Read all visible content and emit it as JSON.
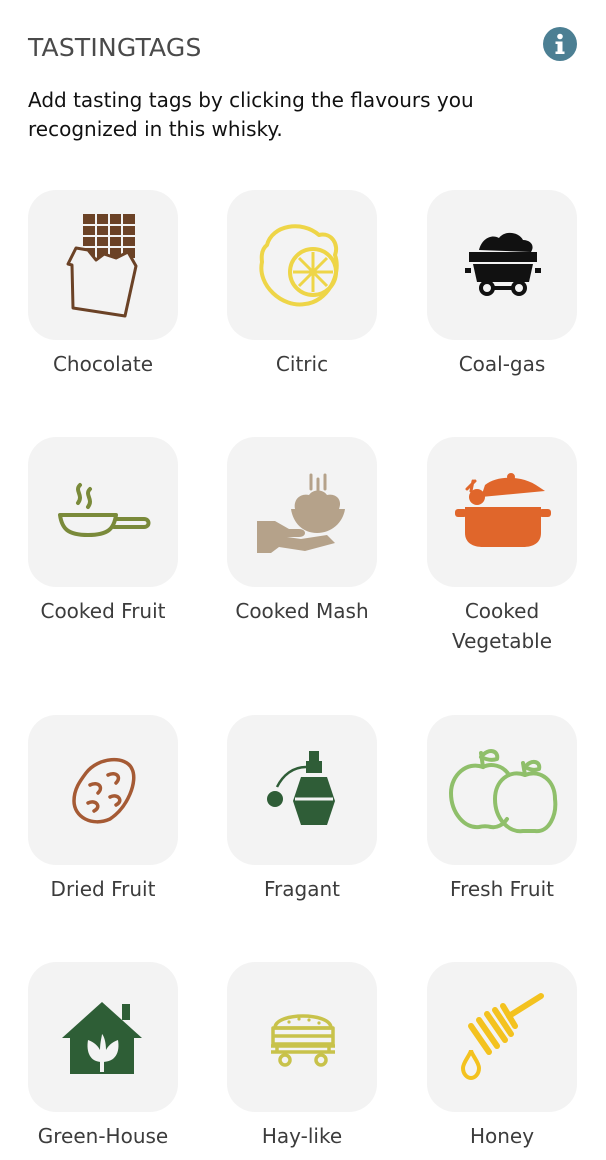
{
  "header": {
    "title": "TASTINGTAGS",
    "info_icon": "info-circle-icon",
    "intro": "Add tasting tags by clicking the flavours you recognized in this whisky."
  },
  "tags": [
    {
      "label": "Chocolate",
      "icon": "chocolate-bar-icon",
      "color": "#6b4226"
    },
    {
      "label": "Citric",
      "icon": "lemon-icon",
      "color": "#eed547"
    },
    {
      "label": "Coal-gas",
      "icon": "coal-cart-icon",
      "color": "#111111"
    },
    {
      "label": "Cooked Fruit",
      "icon": "frying-pan-icon",
      "color": "#7a8a3a"
    },
    {
      "label": "Cooked Mash",
      "icon": "hand-bowl-icon",
      "color": "#b5a28a"
    },
    {
      "label": "Cooked Vegetable",
      "icon": "cooking-pot-icon",
      "color": "#e0662b"
    },
    {
      "label": "Dried Fruit",
      "icon": "raisin-icon",
      "color": "#a55a34"
    },
    {
      "label": "Fragant",
      "icon": "perfume-bottle-icon",
      "color": "#2f5d37"
    },
    {
      "label": "Fresh Fruit",
      "icon": "apples-icon",
      "color": "#8fbf6a"
    },
    {
      "label": "Green-House",
      "icon": "greenhouse-icon",
      "color": "#2e5e36"
    },
    {
      "label": "Hay-like",
      "icon": "hay-cart-icon",
      "color": "#c8c24a"
    },
    {
      "label": "Honey",
      "icon": "honey-dipper-icon",
      "color": "#f3c21f"
    }
  ]
}
